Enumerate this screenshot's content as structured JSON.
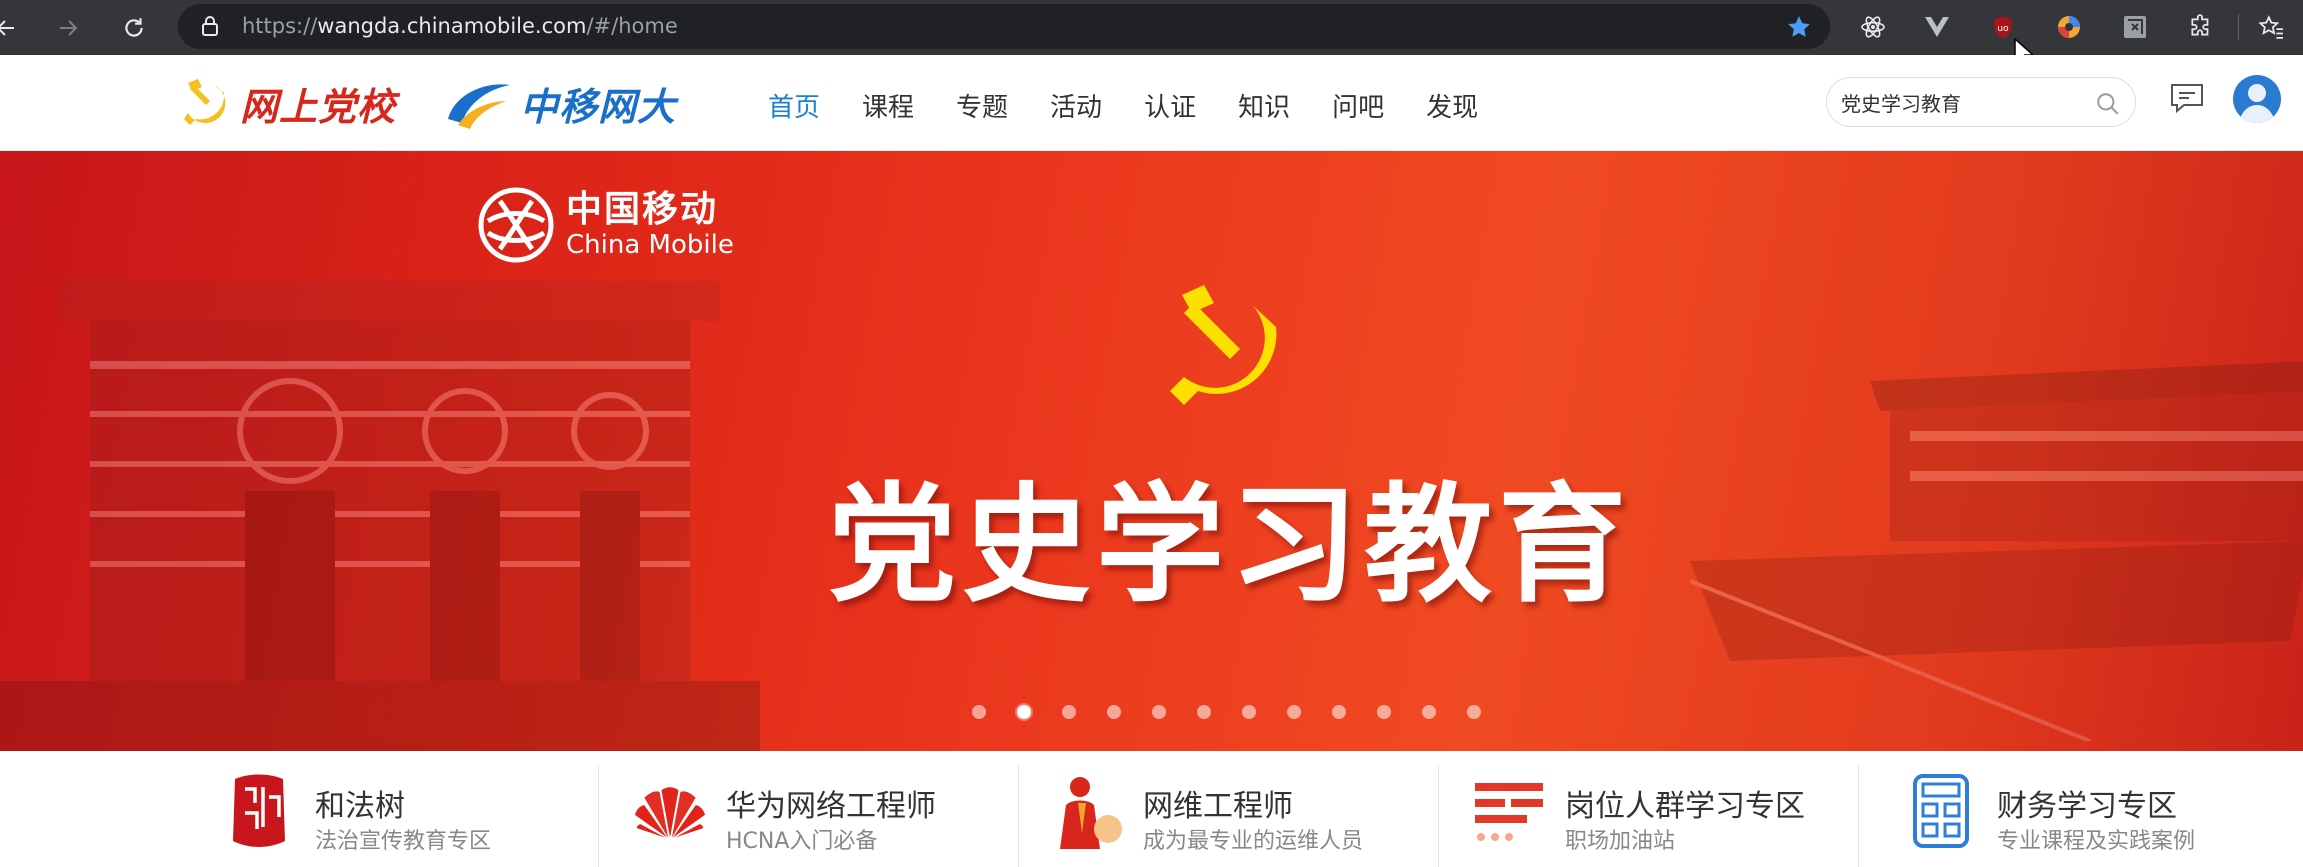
{
  "browser": {
    "url_prefix": "https://",
    "url_host": "wangda.chinamobile.com",
    "url_path": "/#/home"
  },
  "header": {
    "logo_party_school": "网上党校",
    "logo_university": "中移网大",
    "nav": [
      "首页",
      "课程",
      "专题",
      "活动",
      "认证",
      "知识",
      "问吧",
      "发现"
    ],
    "search_value": "党史学习教育"
  },
  "banner": {
    "brand_cn": "中国移动",
    "brand_en": "China Mobile",
    "slogan": "党史学习教育",
    "slide_count": 12,
    "active_slide": 2
  },
  "features": [
    {
      "title": "和法树",
      "subtitle": "法治宣传教育专区",
      "icon": "seal-icon"
    },
    {
      "title": "华为网络工程师",
      "subtitle": "HCNA入门必备",
      "icon": "huawei-logo-icon"
    },
    {
      "title": "网维工程师",
      "subtitle": "成为最专业的运维人员",
      "icon": "engineer-icon"
    },
    {
      "title": "岗位人群学习专区",
      "subtitle": "职场加油站",
      "icon": "list-lines-icon"
    },
    {
      "title": "财务学习专区",
      "subtitle": "专业课程及实践案例",
      "icon": "calculator-icon"
    }
  ],
  "colors": {
    "accent_blue": "#1d7fd0",
    "party_red": "#d7271c",
    "banner_red": "#ec3a1e"
  }
}
